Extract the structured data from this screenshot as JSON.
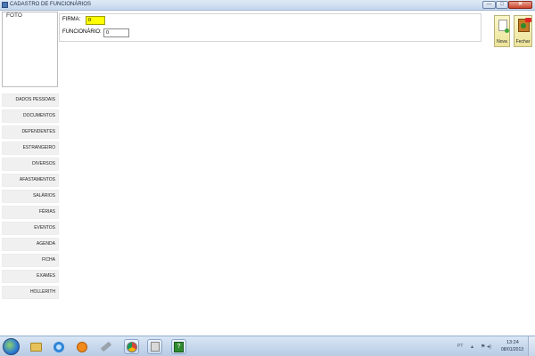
{
  "window": {
    "title": "CADASTRO DE FUNCIONÁRIOS",
    "minimize_label": "—",
    "maximize_label": "□",
    "close_label": "✕"
  },
  "photo": {
    "label": "FOTO"
  },
  "form": {
    "firma_label": "FIRMA:",
    "firma_value": "0",
    "funcionario_label": "FUNCIONÁRIO:",
    "funcionario_value": "0"
  },
  "actions": {
    "nova_label": "Nova",
    "fechar_label": "Fechar"
  },
  "menu": {
    "items": [
      "DADOS PESSOAIS",
      "DOCUMENTOS",
      "DEPENDENTES",
      "ESTRANGEIRO",
      "DIVERSOS",
      "AFASTAMENTOS",
      "SALÁRIOS",
      "FÉRIAS",
      "EVENTOS",
      "AGENDA",
      "FICHA",
      "EXAMES",
      "HOLLERITH"
    ]
  },
  "taskbar": {
    "icons": [
      "start-orb",
      "folder-icon",
      "internet-explorer-icon",
      "media-player-icon",
      "tools-icon",
      "chrome-icon",
      "paint-icon",
      "app-icon"
    ],
    "tray": {
      "language": "PT",
      "up_arrow": "▴",
      "flag": "⚑",
      "volume": "◂)",
      "time": "13:24",
      "date": "08/01/2013"
    }
  },
  "colors": {
    "firma_input_bg": "#ffff00",
    "titlebar_bg": "#c4d6ec",
    "menu_button_bg": "#f0f0f0",
    "close_button_bg": "#c9432c"
  }
}
